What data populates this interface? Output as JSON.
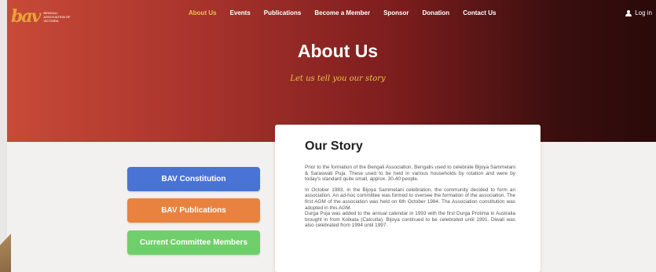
{
  "logo": {
    "mark": "bav",
    "text": "BENGALI ASSOCIATION OF VICTORIA"
  },
  "nav": {
    "items": [
      "About Us",
      "Events",
      "Publications",
      "Become a Member",
      "Sponsor",
      "Donation",
      "Contact Us"
    ],
    "active": "About Us"
  },
  "login": {
    "label": "Log in"
  },
  "hero": {
    "title": "About Us",
    "subtitle": "Let us tell you our story"
  },
  "buttons": {
    "constitution": "BAV Constitution",
    "publications": "BAV Publications",
    "committee": "Current Committee Members"
  },
  "story": {
    "title": "Our Story",
    "paragraphs": [
      "Prior to the formation of the Bengali Association, Bengalis used to celebrate Bijoya Sammelani & Saraswati Puja. These used to be held in various households by rotation and were by today's standard quite small, approx. 30-40 people.",
      "In October 1983, in the Bijoya Sammelani celebration, the community decided to form an association. An ad-hoc committee was formed to oversee the formation of the association. The first AGM of the association was held on 6th October 1984. The Association constitution was adopted in this AGM.",
      "Durga Puja was added to the annual calendar in 1993 with the first Durga Protima in Australia brought in from Kolkata (Calcutta). Bijoya continued to be celebrated until 1991. Diwali was also celebrated from 1994 until 1997."
    ]
  },
  "colors": {
    "accent": "#e8c44a",
    "blue_button": "#4a73d6",
    "orange_button": "#e8823e",
    "green_button": "#6fcf6a"
  }
}
